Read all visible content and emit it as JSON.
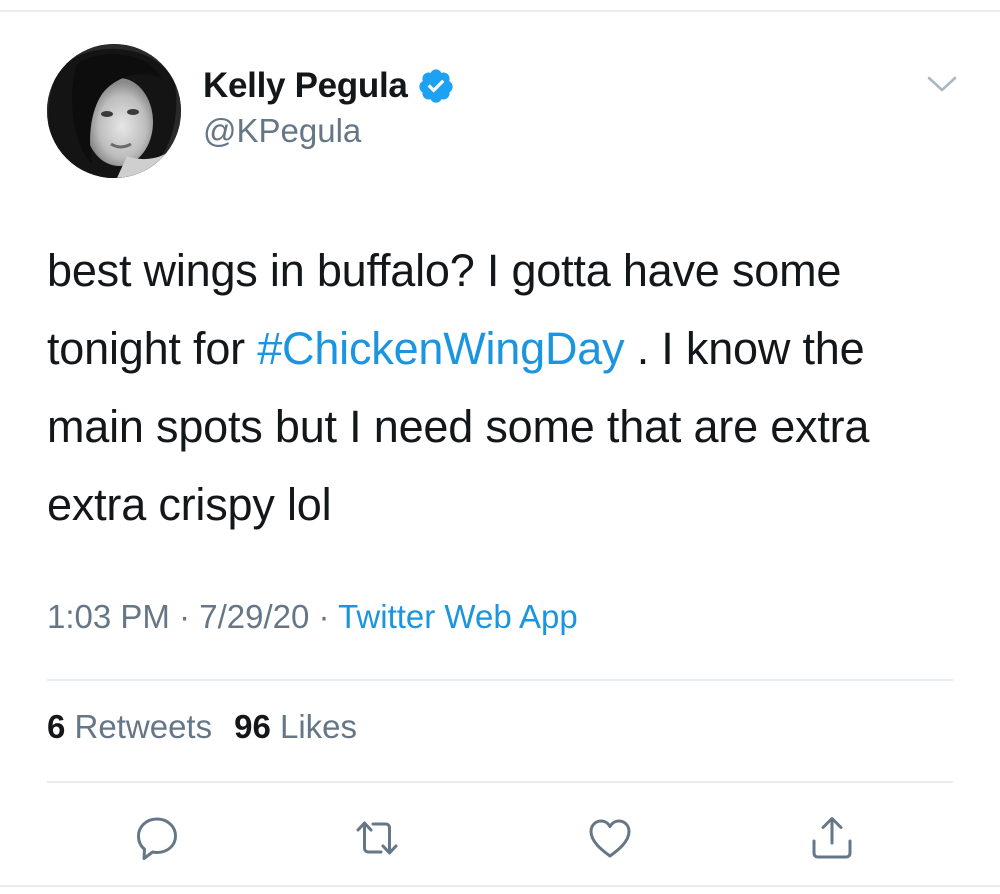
{
  "user": {
    "display_name": "Kelly Pegula",
    "handle": "@KPegula",
    "verified": true,
    "avatar_icon": "profile-photo"
  },
  "tweet": {
    "text_before": "best wings in buffalo? I gotta have some tonight for ",
    "hashtag": "#ChickenWingDay",
    "text_after": " . I know the main spots but I need some that are extra extra crispy lol"
  },
  "meta": {
    "time": "1:03 PM",
    "separator": " · ",
    "date": "7/29/20",
    "source": "Twitter Web App"
  },
  "stats": {
    "retweets_count": "6",
    "retweets_label": "Retweets",
    "likes_count": "96",
    "likes_label": "Likes"
  },
  "actions": [
    {
      "icon": "reply-icon"
    },
    {
      "icon": "retweet-icon"
    },
    {
      "icon": "like-icon"
    },
    {
      "icon": "share-icon"
    }
  ],
  "colors": {
    "link": "#1b95e0",
    "secondary_text": "#657786",
    "primary_text": "#14171a",
    "divider": "#e6ecf0"
  }
}
